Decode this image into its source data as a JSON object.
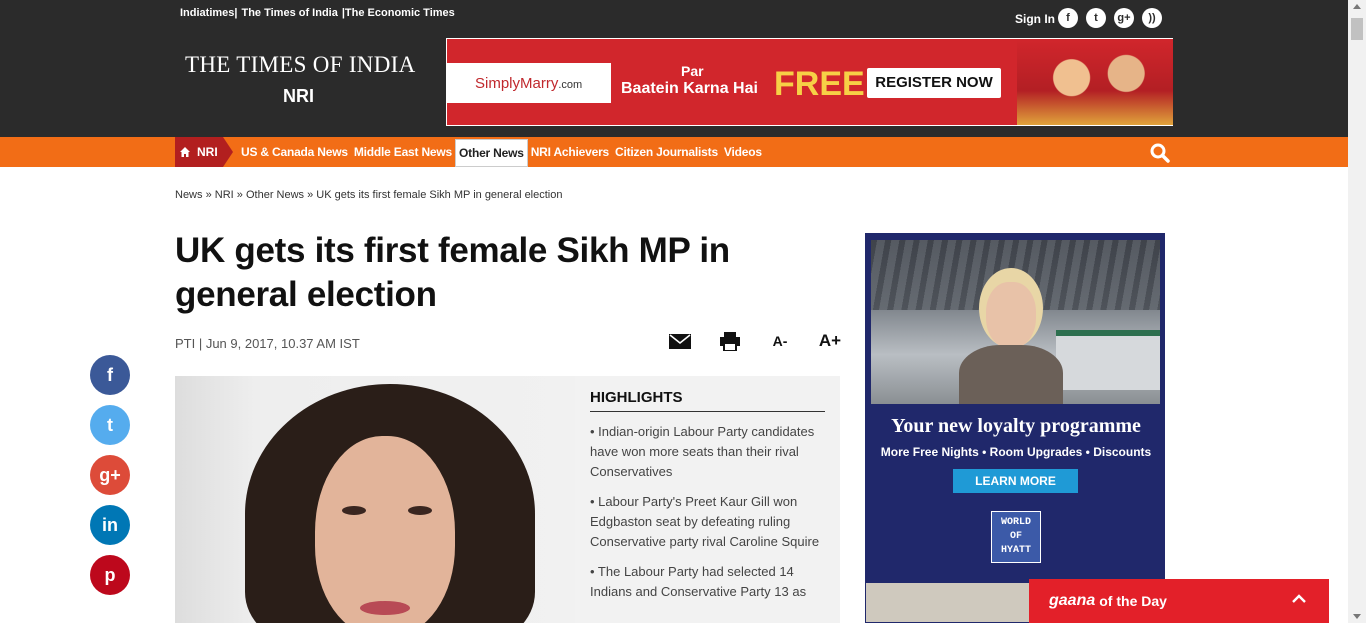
{
  "top_links": [
    "Indiatimes|",
    "The Times of India",
    "|The Economic Times"
  ],
  "signin": "Sign In",
  "social_top": [
    {
      "icon": "facebook-icon",
      "glyph": "f"
    },
    {
      "icon": "twitter-icon",
      "glyph": "t"
    },
    {
      "icon": "google-plus-icon",
      "glyph": "g+"
    },
    {
      "icon": "rss-icon",
      "glyph": "))"
    }
  ],
  "logo": {
    "title": "THE TIMES OF INDIA",
    "section": "NRI"
  },
  "banner": {
    "brand": "SimplyMarry",
    "brand_suffix": ".com",
    "line1": "Par",
    "line2": "Baatein Karna Hai",
    "free": "FREE",
    "cta": "REGISTER NOW"
  },
  "nav": {
    "home_label": "NRI",
    "items": [
      "US & Canada News",
      "Middle East News",
      "Other News",
      "NRI Achievers",
      "Citizen Journalists",
      "Videos"
    ],
    "active": "Other News"
  },
  "breadcrumb": {
    "items": [
      "News",
      "NRI",
      "Other News",
      "UK gets its first female Sikh MP in general election"
    ],
    "separator": "»"
  },
  "article": {
    "headline": "UK gets its first female Sikh MP in general election",
    "byline": "PTI | Jun 9, 2017, 10.37 AM IST",
    "tools": {
      "font_down": "A-",
      "font_up": "A+"
    }
  },
  "share_buttons": [
    {
      "icon": "facebook-icon",
      "glyph": "f",
      "color": "#3b5998"
    },
    {
      "icon": "twitter-icon",
      "glyph": "t",
      "color": "#55acee"
    },
    {
      "icon": "google-plus-icon",
      "glyph": "g+",
      "color": "#dd4b39"
    },
    {
      "icon": "linkedin-icon",
      "glyph": "in",
      "color": "#0077b5"
    },
    {
      "icon": "pinterest-icon",
      "glyph": "p",
      "color": "#bd081c"
    }
  ],
  "highlights": {
    "title": "HIGHLIGHTS",
    "items": [
      "• Indian-origin Labour Party candidates have won more seats than their rival Conservatives",
      "• Labour Party's Preet Kaur Gill won Edgbaston seat by defeating ruling Conservative party rival Caroline Squire",
      "• The Labour Party had selected 14 Indians and Conservative Party 13 as"
    ]
  },
  "ad": {
    "title": "Your new loyalty programme",
    "sub": "More Free Nights • Room Upgrades • Discounts",
    "cta": "LEARN MORE",
    "logo_lines": [
      "WORLD",
      "OF",
      "HYATT"
    ]
  },
  "gaana": {
    "brand": "gaana",
    "label": "of the Day"
  },
  "colors": {
    "nav_orange": "#f26d16",
    "topbar": "#2b2b2b",
    "banner_red": "#d1262c",
    "gaana_red": "#e32029",
    "ad_navy": "#20286b"
  }
}
